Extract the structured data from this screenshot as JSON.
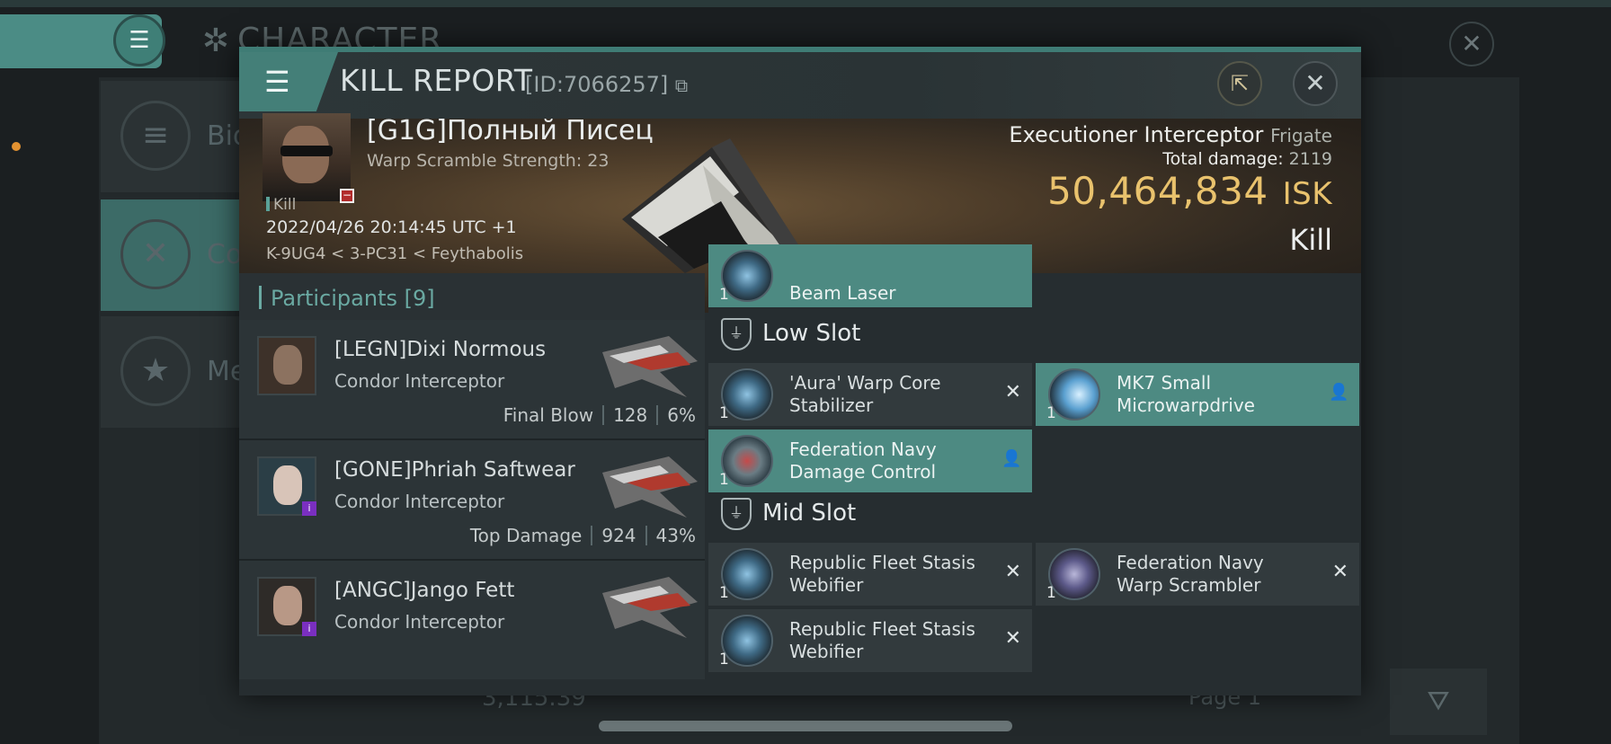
{
  "background": {
    "title": "CHARACTER",
    "sidebar_items": [
      {
        "label": "Bio",
        "icon": "list-icon"
      },
      {
        "label": "Co",
        "icon": "crossed-swords-icon"
      },
      {
        "label": "Me",
        "icon": "star-icon"
      }
    ],
    "bottom_value": "3,115.39",
    "page_label": "Page 1"
  },
  "kill_report": {
    "title": "KILL REPORT",
    "id_label": "[ID:7066257]",
    "victim": {
      "name": "[G1G]Полный Писец",
      "scramble": "Warp Scramble Strength: 23",
      "kill_tag": "Kill",
      "datetime": "2022/04/26 20:14:45 UTC +1",
      "location": "K-9UG4 < 3-PC31 < Feythabolis"
    },
    "ship": {
      "name": "Executioner Interceptor",
      "class": "Frigate",
      "total_damage_label": "Total damage:",
      "total_damage": "2119",
      "isk_value": "50,464,834",
      "isk_unit": "ISK",
      "result": "Kill"
    },
    "participants": {
      "header": "Participants",
      "count": "[9]",
      "rows": [
        {
          "name": "[LEGN]Dixi Normous",
          "ship": "Condor Interceptor",
          "stat_label": "Final Blow",
          "damage": "128",
          "percent": "6%"
        },
        {
          "name": "[GONE]Phriah Saftwear",
          "ship": "Condor Interceptor",
          "stat_label": "Top Damage",
          "damage": "924",
          "percent": "43%"
        },
        {
          "name": "[ANGC]Jango Fett",
          "ship": "Condor Interceptor",
          "stat_label": "",
          "damage": "",
          "percent": ""
        }
      ]
    },
    "fittings": {
      "top_partial": {
        "name": "Beam Laser",
        "qty": "1"
      },
      "low_slot_label": "Low Slot",
      "mid_slot_label": "Mid Slot",
      "low_slot": [
        {
          "name": "'Aura' Warp Core Stabilizer",
          "qty": "1",
          "status": "destroyed"
        },
        {
          "name": "MK7 Small Microwarpdrive",
          "qty": "1",
          "status": "dropped"
        },
        {
          "name": "Federation Navy Damage Control",
          "qty": "1",
          "status": "dropped"
        }
      ],
      "mid_slot": [
        {
          "name": "Republic Fleet Stasis Webifier",
          "qty": "1",
          "status": "destroyed"
        },
        {
          "name": "Federation Navy Warp Scrambler",
          "qty": "1",
          "status": "destroyed"
        },
        {
          "name": "Republic Fleet Stasis Webifier",
          "qty": "1",
          "status": "destroyed"
        }
      ]
    }
  },
  "colors": {
    "accent_teal": "#4d8a82",
    "isk_gold": "#e9c26d",
    "panel": "#262d30"
  }
}
